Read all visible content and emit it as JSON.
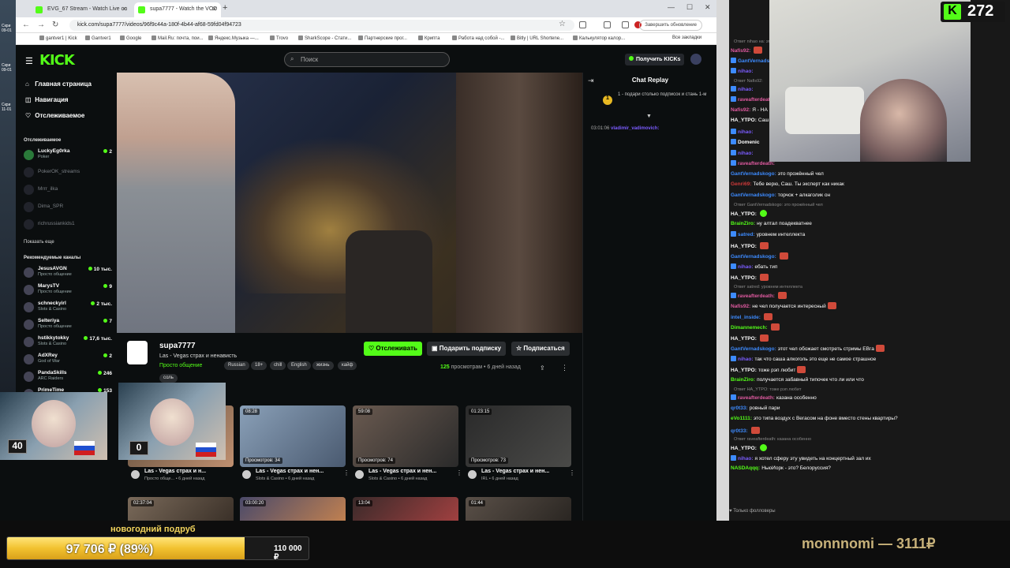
{
  "browser": {
    "tabs": [
      {
        "title": "EVG_67 Stream - Watch Live on"
      },
      {
        "title": "supa7777 - Watch the VOD"
      }
    ],
    "url": "kick.com/supa7777/videos/96f9c44a-180f-4b44-af68-59fd04f94723",
    "update_label": "Завершить обновление",
    "bookmarks": [
      "gantver1 | Kick",
      "Gantver1",
      "Google",
      "Mail.Ru: почта, пои...",
      "Яндекс.Музыка —...",
      "Trovo",
      "SharkScope - Стати...",
      "Партнерские прог...",
      "Криптa",
      "Работа над собой -...",
      "Bitly | URL Shortene...",
      "Калькулятор калор...",
      "Все закладки"
    ]
  },
  "kick": {
    "logo": "KICK",
    "search_placeholder": "Поиск",
    "get_kicks": "Получить KICKs",
    "nav": [
      {
        "label": "Главная страница",
        "icon": "home-icon"
      },
      {
        "label": "Навигация",
        "icon": "compass-icon"
      },
      {
        "label": "Отслеживаемое",
        "icon": "heart-icon"
      }
    ],
    "following_header": "Отслеживаемое",
    "following": [
      {
        "name": "LuckyEg0rka",
        "sub": "Poker",
        "count": "2",
        "live": true
      },
      {
        "name": "PokerOK_streams",
        "sub": "",
        "count": "",
        "live": false
      },
      {
        "name": "Mrrr_ilka",
        "sub": "",
        "count": "",
        "live": false
      },
      {
        "name": "Dima_SPR",
        "sub": "",
        "count": "",
        "live": false
      },
      {
        "name": "richrussiankids1",
        "sub": "",
        "count": "",
        "live": false
      }
    ],
    "show_more": "Показать еще",
    "recommended_header": "Рекомендуемые каналы",
    "recommended": [
      {
        "name": "JesusAVGN",
        "sub": "Просто общение",
        "count": "10 тыс."
      },
      {
        "name": "MarysTV",
        "sub": "Просто общение",
        "count": "9"
      },
      {
        "name": "schneckyirl",
        "sub": "Slots & Casino",
        "count": "2 тыс."
      },
      {
        "name": "Selteriya",
        "sub": "Просто общение",
        "count": "7"
      },
      {
        "name": "hstikkytokky",
        "sub": "Slots & Casino",
        "count": "17,6 тыс."
      },
      {
        "name": "AdXRey",
        "sub": "God of War",
        "count": "2"
      },
      {
        "name": "PandaSkills",
        "sub": "ARC Raiders",
        "count": "246"
      },
      {
        "name": "PrimeTime",
        "sub": "",
        "count": "153"
      }
    ],
    "channel": {
      "name": "supa7777",
      "title": "Las - Vegas  страх и  ненависть",
      "category": "Просто общение",
      "tags": [
        "Russian",
        "18+",
        "chill",
        "English",
        "жизнь",
        "кайф"
      ],
      "tag_extra": "соль",
      "follow": "Отслеживать",
      "subscribe_gift": "Подарить подписку",
      "subscribe": "Подписаться",
      "views_count": "125",
      "views_label": "просмотрам",
      "ago": "6 дней назад"
    },
    "videos": [
      {
        "duration": "",
        "views": "",
        "title": "Las - Vegas страх и н...",
        "sub": "Просто обще...",
        "ago": "6 дней назад"
      },
      {
        "duration": "08:28",
        "views": "Просмотров: 34",
        "title": "Las - Vegas страх и нен...",
        "sub": "Slots & Casino",
        "ago": "6 дней назад"
      },
      {
        "duration": "59:08",
        "views": "Просмотров: 74",
        "title": "Las - Vegas страх и нен...",
        "sub": "Slots & Casino",
        "ago": "6 дней назад"
      },
      {
        "duration": "01:23:15",
        "views": "Просмотров: 73",
        "title": "Las - Vegas страх и нен...",
        "sub": "IRL",
        "ago": "6 дней назад"
      }
    ],
    "videos_row2": [
      {
        "duration": "02:37:04"
      },
      {
        "duration": "03:00:20"
      },
      {
        "duration": "13:04"
      },
      {
        "duration": "01:44"
      }
    ],
    "chat_replay": {
      "title": "Chat Replay",
      "pinned": "1 - подари столько подписок и стань 1-м",
      "pinned_rank": "1",
      "first_time": "03:01:06",
      "first_user": "vladimir_vadimovich:"
    }
  },
  "overlay": {
    "kick_count": "272",
    "webcam_left_badge": "40",
    "webcam_mid_badge": "0",
    "goal_title": "новогодний подруб",
    "goal_progress_text": "97 706 ₽ (89%)",
    "goal_fraction": 0.89,
    "goal_target": "110 000 ₽",
    "donor_text": "monnnomi — 3111₽",
    "footer": "Только фолловеры"
  },
  "right_chat": [
    {
      "type": "reply",
      "text": "Ответ nihao на: это..."
    },
    {
      "user": "Nafis92:",
      "color": "#e05aa0",
      "text": "",
      "emote": "red"
    },
    {
      "user": "GantVernadskogo:",
      "color": "#3d8bff",
      "text": "",
      "badge": true
    },
    {
      "user": "nihao:",
      "color": "#7b5cff",
      "text": "",
      "badge": true
    },
    {
      "type": "reply",
      "text": "Ответ Nafis92:"
    },
    {
      "user": "nihao:",
      "color": "#7b5cff",
      "text": "",
      "badge": true
    },
    {
      "user": "raveafterdeath:",
      "color": "#e05aa0",
      "text": "",
      "badge": true
    },
    {
      "user": "Nafis92:",
      "color": "#e05aa0",
      "text": "Я - НА"
    },
    {
      "user": "HA_YTPO:",
      "color": "#ffffff",
      "text": "Саш"
    },
    {
      "user": "nihao:",
      "color": "#7b5cff",
      "text": "",
      "badge": true
    },
    {
      "user": "Domenic",
      "color": "#ffffff",
      "text": "",
      "badge": true
    },
    {
      "user": "nihao:",
      "color": "#7b5cff",
      "text": "",
      "badge": true
    },
    {
      "user": "raveafterdeath:",
      "color": "#e05aa0",
      "text": "",
      "badge": true
    },
    {
      "user": "GantVernadskogo:",
      "color": "#3d8bff",
      "text": "это прожённый чел"
    },
    {
      "user": "Genri69:",
      "color": "#d03a3a",
      "text": "Тебе верю, Саш. Ты эксперт как никак"
    },
    {
      "user": "GantVernadskogo:",
      "color": "#3d8bff",
      "text": "торчок + алкаголик он"
    },
    {
      "type": "reply",
      "text": "Ответ GantVernadskogo: это прожённый чел"
    },
    {
      "user": "HA_YTPO:",
      "color": "#ffffff",
      "text": "",
      "emote": "green"
    },
    {
      "user": "BrainZiro:",
      "color": "#53fc18",
      "text": "ну алтал поадекватнее"
    },
    {
      "user": "satred:",
      "color": "#3d8bff",
      "text": "уровнем интеллекта",
      "badge": true
    },
    {
      "user": "HA_YTPO:",
      "color": "#ffffff",
      "text": "",
      "emote": "red"
    },
    {
      "user": "GantVernadskogo:",
      "color": "#3d8bff",
      "text": "",
      "emote": "red"
    },
    {
      "user": "nihao:",
      "color": "#7b5cff",
      "text": "ебать тип",
      "badge": true
    },
    {
      "user": "HA_YTPO:",
      "color": "#ffffff",
      "text": "",
      "emote": "red"
    },
    {
      "type": "reply",
      "text": "Ответ satred: уровнем интеллекта"
    },
    {
      "user": "raveafterdeath:",
      "color": "#e05aa0",
      "text": "",
      "emote": "red",
      "badge": true
    },
    {
      "user": "Nafis92:",
      "color": "#e05aa0",
      "text": "не чел получается интересный",
      "emote": "red"
    },
    {
      "user": "intel_inside:",
      "color": "#3d8bff",
      "text": "",
      "emote": "red"
    },
    {
      "user": "Dimannemech:",
      "color": "#53fc18",
      "text": "",
      "emote": "red"
    },
    {
      "user": "HA_YTPO:",
      "color": "#ffffff",
      "text": "",
      "emote": "red"
    },
    {
      "user": "GantVernadskogo:",
      "color": "#3d8bff",
      "text": "этот чел обожает смотреть стримы ЕВга",
      "emote": "red"
    },
    {
      "user": "nihao:",
      "color": "#7b5cff",
      "text": "так что саша алкоголь это еще не самое страшное",
      "badge": true
    },
    {
      "user": "HA_YTPO:",
      "color": "#ffffff",
      "text": "тоже рэп любит",
      "emote": "red"
    },
    {
      "user": "BrainZiro:",
      "color": "#53fc18",
      "text": "получается забавный типочек что ли или что"
    },
    {
      "type": "reply",
      "text": "Ответ HA_YTPO: тоже рэп любит"
    },
    {
      "user": "raveafterdeath:",
      "color": "#e05aa0",
      "text": "казана особенно",
      "badge": true
    },
    {
      "user": "qr0t33:",
      "color": "#3d8bff",
      "text": "ровный пари"
    },
    {
      "user": "eVo1111:",
      "color": "#53fc18",
      "text": "это типа воздух с Вегасом на фоне вместо стены квартиры?"
    },
    {
      "user": "qr0t33:",
      "color": "#3d8bff",
      "text": "",
      "emote": "red"
    },
    {
      "type": "reply",
      "text": "Ответ raveafterdeath: казана особенно"
    },
    {
      "user": "HA_YTPO:",
      "color": "#ffffff",
      "text": "",
      "emote": "green"
    },
    {
      "user": "nihao:",
      "color": "#7b5cff",
      "text": "я хотел сферу эту увидеть на концертный зал их",
      "badge": true
    },
    {
      "user": "NASDAqqq:",
      "color": "#53fc18",
      "text": "НьюЙорк - это? Белоруссия?"
    }
  ]
}
